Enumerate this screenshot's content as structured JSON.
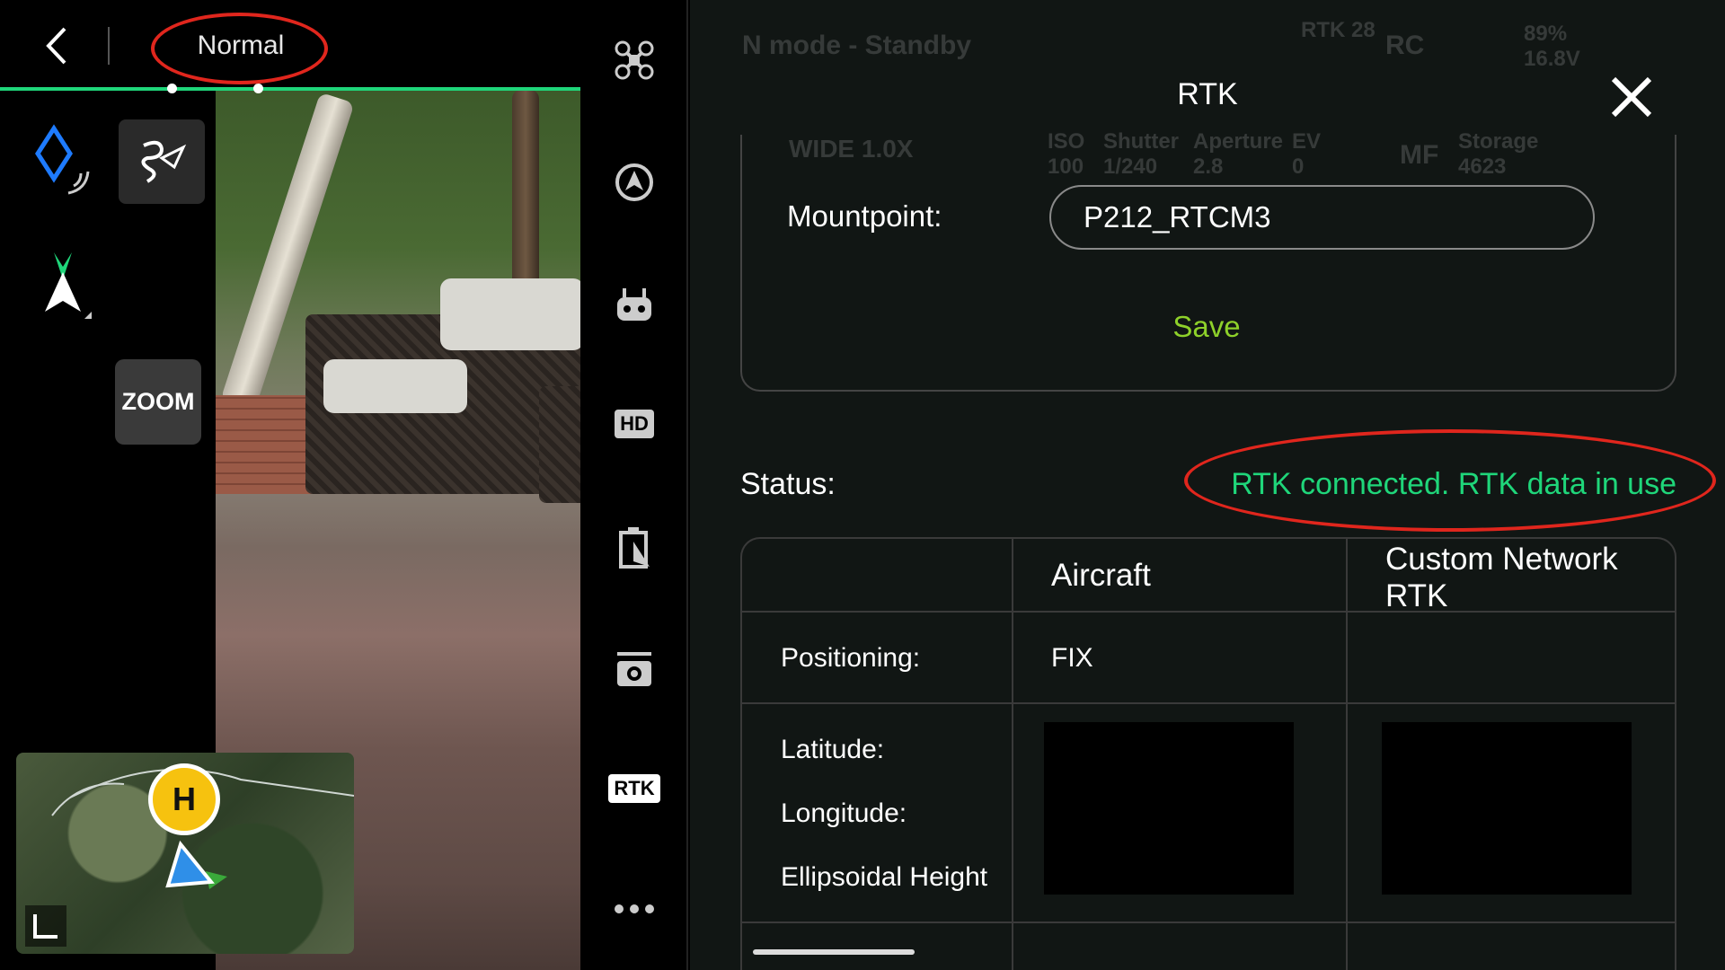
{
  "flight_mode": {
    "label": "Normal"
  },
  "left_controls": {
    "zoom_label": "ZOOM"
  },
  "minimap": {
    "home_label": "H"
  },
  "nav_rail": {
    "hd_label": "HD",
    "rtk_label": "RTK"
  },
  "rtk_panel": {
    "title": "RTK",
    "mountpoint_label": "Mountpoint:",
    "mountpoint_value": "P212_RTCM3",
    "save_label": "Save",
    "status_label": "Status:",
    "status_value": "RTK connected. RTK data in use",
    "table": {
      "headers": [
        "Aircraft",
        "Custom Network RTK"
      ],
      "rows": [
        {
          "label": "Positioning:",
          "aircraft": "FIX",
          "network": ""
        },
        {
          "label": "Latitude:"
        },
        {
          "label": "Longitude:"
        },
        {
          "label": "Ellipsoidal Height"
        }
      ]
    }
  },
  "background_hud": {
    "mode_status": "N mode - Standby",
    "rtk_count": "RTK 28",
    "rc_label": "RC",
    "battery": "89% 16.8V",
    "camera_lens": "WIDE 1.0X",
    "iso": "ISO 100",
    "shutter": "Shutter 1/240",
    "aperture": "Aperture 2.8",
    "ev": "EV 0",
    "mf": "MF",
    "storage": "Storage 4623"
  },
  "colors": {
    "accent_green": "#1fd67a",
    "save_green": "#8ed12a",
    "annotation_red": "#e0261d",
    "home_yellow": "#f6c20f"
  },
  "icons": [
    "back-arrow-icon",
    "waypoint-icon",
    "trajectory-icon",
    "nav-arrow-icon",
    "drone-icon",
    "aircraft-status-icon",
    "remote-controller-icon",
    "hd-icon",
    "battery-icon",
    "camera-icon",
    "rtk-icon",
    "more-icon",
    "close-icon"
  ]
}
